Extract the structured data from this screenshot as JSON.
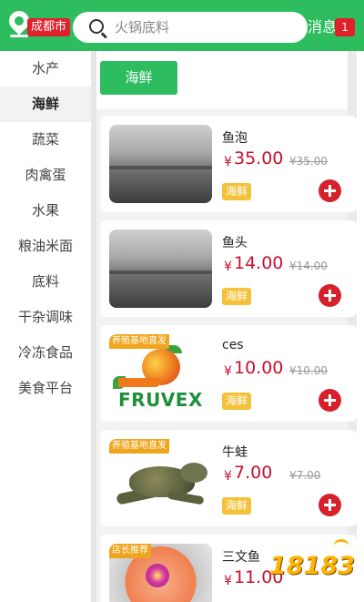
{
  "header": {
    "city": "成都市",
    "search_placeholder": "火锅底料",
    "message_label": "消息",
    "message_count": "1"
  },
  "sidebar": {
    "items": [
      {
        "label": "水产",
        "active": false
      },
      {
        "label": "海鲜",
        "active": true
      },
      {
        "label": "蔬菜",
        "active": false
      },
      {
        "label": "肉禽蛋",
        "active": false
      },
      {
        "label": "水果",
        "active": false
      },
      {
        "label": "粮油米面",
        "active": false
      },
      {
        "label": "底料",
        "active": false
      },
      {
        "label": "干杂调味",
        "active": false
      },
      {
        "label": "冷冻食品",
        "active": false
      },
      {
        "label": "美食平台",
        "active": false
      }
    ]
  },
  "subcategory": {
    "label": "海鲜"
  },
  "products": [
    {
      "name": "鱼泡",
      "price": "35.00",
      "original_price": "¥35.00",
      "tag": "海鲜",
      "ribbon": "",
      "image": "dark-sea-photo"
    },
    {
      "name": "鱼头",
      "price": "14.00",
      "original_price": "¥14.00",
      "tag": "海鲜",
      "ribbon": "",
      "image": "dark-sea-photo"
    },
    {
      "name": "ces",
      "price": "10.00",
      "original_price": "¥10.00",
      "tag": "海鲜",
      "ribbon": "养殖基地直发",
      "image": "fruvex-logo",
      "image_text": "FRUVEX"
    },
    {
      "name": "牛蛙",
      "price": "7.00",
      "original_price": "¥7.00",
      "tag": "海鲜",
      "ribbon": "养殖基地直发",
      "image": "bullfrog-photo"
    },
    {
      "name": "三文鱼",
      "price": "11.00",
      "original_price": "",
      "tag": "",
      "ribbon": "店长推荐",
      "image": "salmon-sashimi-photo"
    }
  ],
  "currency_symbol": "¥",
  "watermark": {
    "text": "18183"
  },
  "colors": {
    "primary": "#2dbd5f",
    "price": "#c8102e",
    "badge": "#e0202a",
    "tag": "#f3c13a",
    "ribbon": "#f0a51e"
  }
}
